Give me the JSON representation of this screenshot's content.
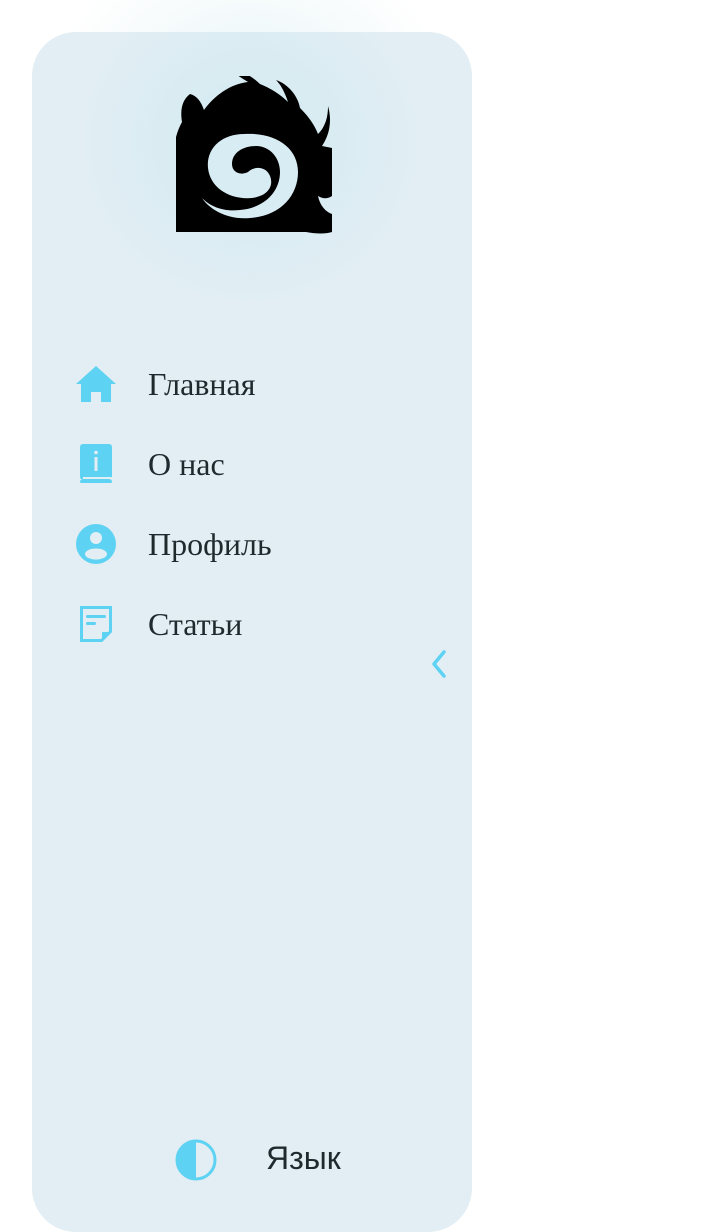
{
  "brand": {
    "logo_icon": "swirl-creature-logo"
  },
  "nav": {
    "items": [
      {
        "label": "Главная",
        "icon": "home-icon"
      },
      {
        "label": "О нас",
        "icon": "info-book-icon"
      },
      {
        "label": "Профиль",
        "icon": "user-circle-icon"
      },
      {
        "label": "Статьи",
        "icon": "article-note-icon"
      }
    ]
  },
  "sidebar": {
    "collapse_icon": "chevron-left-icon"
  },
  "footer": {
    "theme_icon": "contrast-half-circle-icon",
    "language_label": "Язык"
  },
  "colors": {
    "sidebar_bg": "#e2eef3",
    "accent": "#5ed2f2",
    "text": "#1f2a2e",
    "logo": "#000000"
  }
}
